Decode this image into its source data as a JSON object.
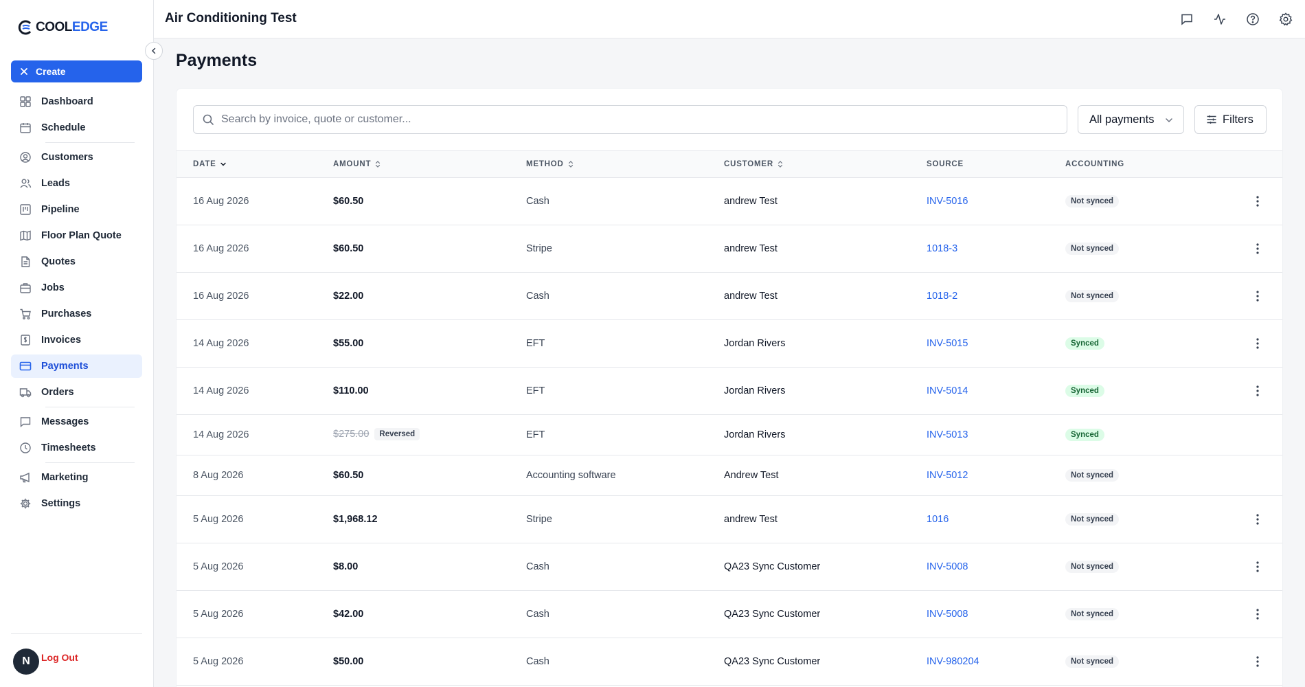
{
  "brand": {
    "logo_cool": "COOL",
    "logo_edge": "EDGE"
  },
  "sidebar": {
    "create_label": "Create",
    "items": [
      {
        "label": "Dashboard",
        "icon": "dashboard-icon"
      },
      {
        "label": "Schedule",
        "icon": "calendar-icon"
      },
      {
        "label": "Customers",
        "icon": "user-circle-icon"
      },
      {
        "label": "Leads",
        "icon": "users-icon"
      },
      {
        "label": "Pipeline",
        "icon": "kanban-icon"
      },
      {
        "label": "Floor Plan Quote",
        "icon": "map-icon"
      },
      {
        "label": "Quotes",
        "icon": "document-icon"
      },
      {
        "label": "Jobs",
        "icon": "briefcase-icon"
      },
      {
        "label": "Purchases",
        "icon": "cart-icon"
      },
      {
        "label": "Invoices",
        "icon": "invoice-icon"
      },
      {
        "label": "Payments",
        "icon": "credit-card-icon",
        "active": true
      },
      {
        "label": "Orders",
        "icon": "truck-icon"
      },
      {
        "label": "Messages",
        "icon": "message-icon"
      },
      {
        "label": "Timesheets",
        "icon": "clock-icon"
      },
      {
        "label": "Marketing",
        "icon": "megaphone-icon"
      },
      {
        "label": "Settings",
        "icon": "gear-icon"
      }
    ],
    "avatar_initial": "N",
    "logout_label": "Log Out"
  },
  "topbar": {
    "title": "Air Conditioning Test",
    "icons": [
      "chat-icon",
      "activity-icon",
      "help-icon",
      "settings-icon"
    ]
  },
  "page": {
    "title": "Payments",
    "search_placeholder": "Search by invoice, quote or customer...",
    "filter_select": "All payments",
    "filters_label": "Filters"
  },
  "table": {
    "headers": {
      "date": "DATE",
      "amount": "AMOUNT",
      "method": "METHOD",
      "customer": "CUSTOMER",
      "source": "SOURCE",
      "accounting": "ACCOUNTING"
    },
    "rows": [
      {
        "date": "16 Aug 2026",
        "amount": "$60.50",
        "method": "Cash",
        "customer": "andrew Test",
        "source": "INV-5016",
        "accounting": "Not synced",
        "menu": true
      },
      {
        "date": "16 Aug 2026",
        "amount": "$60.50",
        "method": "Stripe",
        "customer": "andrew Test",
        "source": "1018-3",
        "accounting": "Not synced",
        "menu": true
      },
      {
        "date": "16 Aug 2026",
        "amount": "$22.00",
        "method": "Cash",
        "customer": "andrew Test",
        "source": "1018-2",
        "accounting": "Not synced",
        "menu": true
      },
      {
        "date": "14 Aug 2026",
        "amount": "$55.00",
        "method": "EFT",
        "customer": "Jordan Rivers",
        "source": "INV-5015",
        "accounting": "Synced",
        "menu": true
      },
      {
        "date": "14 Aug 2026",
        "amount": "$110.00",
        "method": "EFT",
        "customer": "Jordan Rivers",
        "source": "INV-5014",
        "accounting": "Synced",
        "menu": true
      },
      {
        "date": "14 Aug 2026",
        "amount": "$275.00",
        "reversed": "Reversed",
        "method": "EFT",
        "customer": "Jordan Rivers",
        "source": "INV-5013",
        "accounting": "Synced",
        "menu": false
      },
      {
        "date": "8 Aug 2026",
        "amount": "$60.50",
        "method": "Accounting software",
        "customer": "Andrew Test",
        "source": "INV-5012",
        "accounting": "Not synced",
        "menu": false
      },
      {
        "date": "5 Aug 2026",
        "amount": "$1,968.12",
        "method": "Stripe",
        "customer": "andrew Test",
        "source": "1016",
        "accounting": "Not synced",
        "menu": true
      },
      {
        "date": "5 Aug 2026",
        "amount": "$8.00",
        "method": "Cash",
        "customer": "QA23 Sync Customer",
        "source": "INV-5008",
        "accounting": "Not synced",
        "menu": true
      },
      {
        "date": "5 Aug 2026",
        "amount": "$42.00",
        "method": "Cash",
        "customer": "QA23 Sync Customer",
        "source": "INV-5008",
        "accounting": "Not synced",
        "menu": true
      },
      {
        "date": "5 Aug 2026",
        "amount": "$50.00",
        "method": "Cash",
        "customer": "QA23 Sync Customer",
        "source": "INV-980204",
        "accounting": "Not synced",
        "menu": true
      }
    ]
  }
}
